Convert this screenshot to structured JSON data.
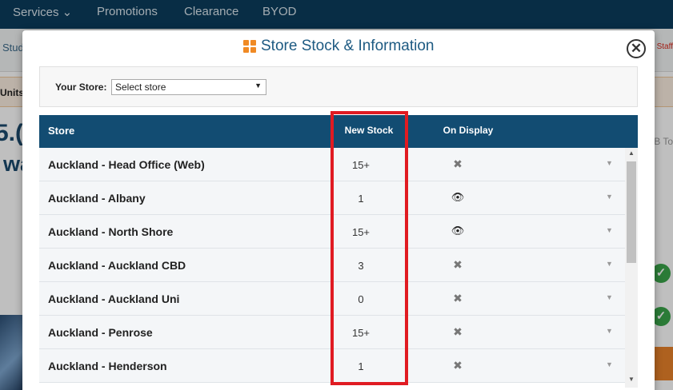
{
  "nav": {
    "items": [
      "Services ⌄",
      "Promotions",
      "Clearance",
      "BYOD"
    ]
  },
  "background": {
    "crumb_left": "Stud",
    "staff_tag": "Staff",
    "units_text": "Units",
    "price_fragment": "5.(",
    "wa_fragment": "wa",
    "pb_text": "PB To"
  },
  "modal": {
    "title": "Store Stock & Information",
    "close_symbol": "✕",
    "store_label": "Your Store:",
    "store_select_value": "Select store",
    "columns": {
      "store": "Store",
      "new_stock": "New Stock",
      "on_display": "On Display"
    },
    "rows": [
      {
        "store": "Auckland - Head Office (Web)",
        "new_stock": "15+",
        "on_display": "✖"
      },
      {
        "store": "Auckland - Albany",
        "new_stock": "1",
        "on_display": "👁"
      },
      {
        "store": "Auckland - North Shore",
        "new_stock": "15+",
        "on_display": "👁"
      },
      {
        "store": "Auckland - Auckland CBD",
        "new_stock": "3",
        "on_display": "✖"
      },
      {
        "store": "Auckland - Auckland Uni",
        "new_stock": "0",
        "on_display": "✖"
      },
      {
        "store": "Auckland - Penrose",
        "new_stock": "15+",
        "on_display": "✖"
      },
      {
        "store": "Auckland - Henderson",
        "new_stock": "1",
        "on_display": "✖"
      }
    ]
  },
  "colors": {
    "header_blue": "#124c72",
    "title_blue": "#1d5a82",
    "accent_orange": "#f08a24",
    "highlight_red": "#e01b22"
  }
}
